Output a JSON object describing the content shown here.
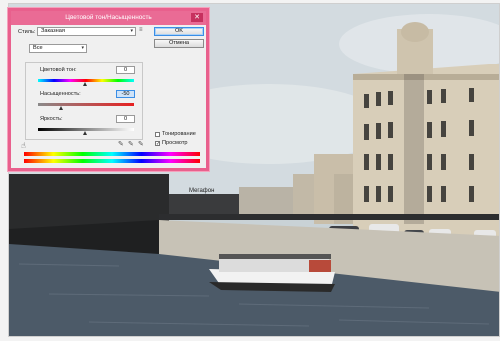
{
  "dialog": {
    "title": "Цветовой тон/Насыщенность",
    "close_glyph": "✕",
    "style_label": "Стиль:",
    "style_value": "Заказная",
    "style_menu_icon": "list-menu-icon",
    "ok_label": "OK",
    "cancel_label": "Отмена",
    "channel_value": "Все",
    "hue": {
      "label": "Цветовой тон:",
      "value": "0"
    },
    "saturation": {
      "label": "Насыщенность:",
      "value": "-50"
    },
    "lightness": {
      "label": "Яркость:",
      "value": "0"
    },
    "colorize_label": "Тонирование",
    "colorize_checked": false,
    "preview_label": "Просмотр",
    "preview_checked": true,
    "hand_tool_icon": "hand-tool-icon",
    "eyedropper_icons": [
      "eyedropper-icon",
      "eyedropper-plus-icon",
      "eyedropper-minus-icon"
    ]
  },
  "photo": {
    "storefront_sign": "Мегафон",
    "palette": {
      "sky": "#d4dde2",
      "building": "#d7cdbb",
      "water": "#4b5866",
      "embankment": "#c9c4b8"
    }
  }
}
